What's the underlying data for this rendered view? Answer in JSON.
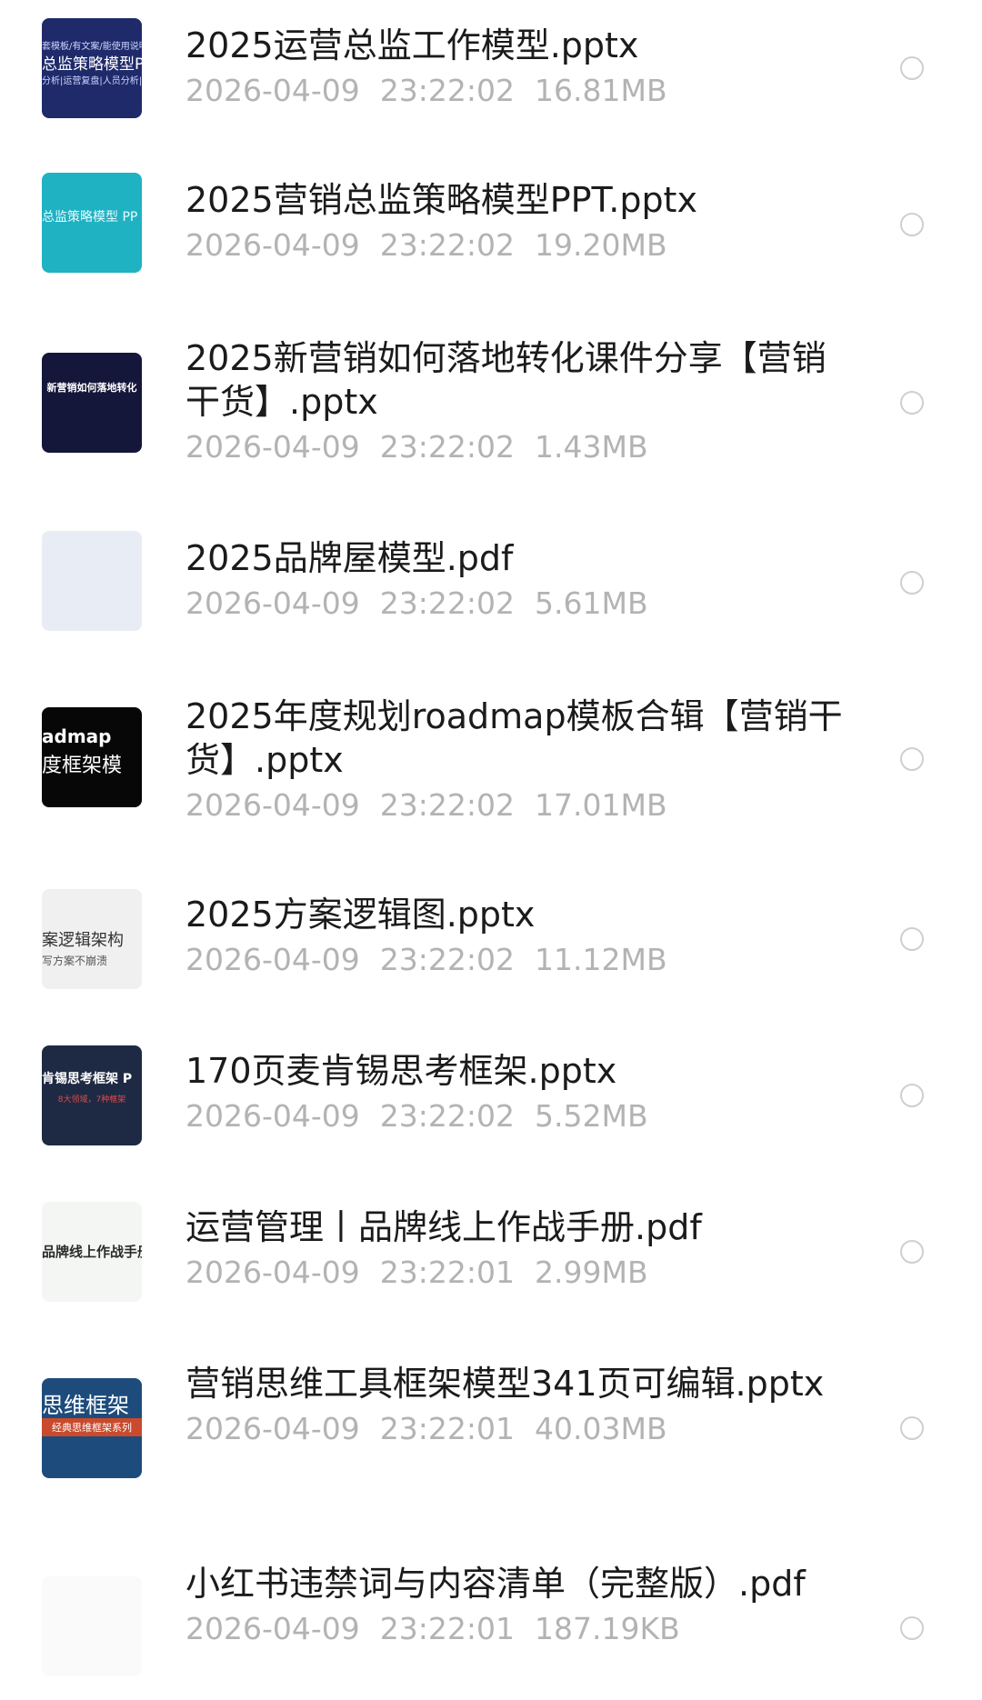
{
  "files": [
    {
      "name": "2025运营总监工作模型.pptx",
      "date": "2026-04-09",
      "time": "23:22:02",
      "size": "16.81MB",
      "thumb": {
        "line1": "套模板/有文案/能使用说明",
        "line2": "总监策略模型PP",
        "line3": "分析|运营复盘|人员分析|绩"
      }
    },
    {
      "name": "2025营销总监策略模型PPT.pptx",
      "date": "2026-04-09",
      "time": "23:22:02",
      "size": "19.20MB",
      "thumb": {
        "line1": "总监策略模型 PP"
      }
    },
    {
      "name": "2025新营销如何落地转化课件分享【营销干货】.pptx",
      "date": "2026-04-09",
      "time": "23:22:02",
      "size": "1.43MB",
      "thumb": {
        "line1": "新营销如何落地转化"
      }
    },
    {
      "name": "2025品牌屋模型.pdf",
      "date": "2026-04-09",
      "time": "23:22:02",
      "size": "5.61MB",
      "thumb": {}
    },
    {
      "name": "2025年度规划roadmap模板合辑【营销干货】.pptx",
      "date": "2026-04-09",
      "time": "23:22:02",
      "size": "17.01MB",
      "thumb": {
        "line1": "admap",
        "line2": "度框架模"
      }
    },
    {
      "name": "2025方案逻辑图.pptx",
      "date": "2026-04-09",
      "time": "23:22:02",
      "size": "11.12MB",
      "thumb": {
        "line1": "案逻辑架构",
        "line2": "写方案不崩溃"
      }
    },
    {
      "name": "170页麦肯锡思考框架.pptx",
      "date": "2026-04-09",
      "time": "23:22:02",
      "size": "5.52MB",
      "thumb": {
        "line1": "肯锡思考框架 P",
        "line2": "8大领域，7种框架"
      }
    },
    {
      "name": "运营管理丨品牌线上作战手册.pdf",
      "date": "2026-04-09",
      "time": "23:22:01",
      "size": "2.99MB",
      "thumb": {
        "line1": "品牌线上作战手册"
      }
    },
    {
      "name": "营销思维工具框架模型341页可编辑.pptx",
      "date": "2026-04-09",
      "time": "23:22:01",
      "size": "40.03MB",
      "thumb": {
        "line1": "思维框架",
        "line2": "经典思维框架系列"
      }
    },
    {
      "name": "小红书违禁词与内容清单（完整版）.pdf",
      "date": "2026-04-09",
      "time": "23:22:01",
      "size": "187.19KB",
      "thumb": {}
    }
  ]
}
